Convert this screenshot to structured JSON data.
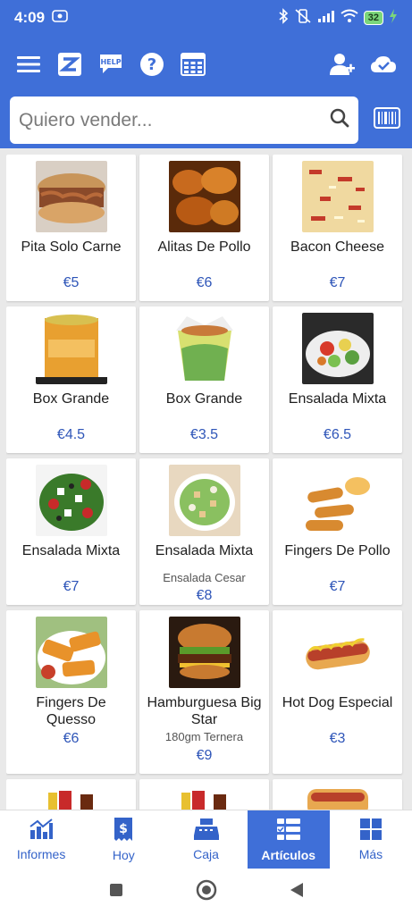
{
  "status": {
    "time": "4:09",
    "battery": "32"
  },
  "search": {
    "placeholder": "Quiero vender..."
  },
  "products": [
    {
      "name": "Pita Solo Carne",
      "price": "€5"
    },
    {
      "name": "Alitas De Pollo",
      "price": "€6"
    },
    {
      "name": "Bacon Cheese",
      "price": "€7"
    },
    {
      "name": "Box Grande",
      "price": "€4.5"
    },
    {
      "name": "Box Grande",
      "price": "€3.5"
    },
    {
      "name": "Ensalada Mixta",
      "price": "€6.5"
    },
    {
      "name": "Ensalada Mixta",
      "price": "€7"
    },
    {
      "name": "Ensalada Mixta",
      "subtitle": "Ensalada Cesar",
      "price": "€8"
    },
    {
      "name": "Fingers De Pollo",
      "price": "€7"
    },
    {
      "name": "Fingers De Quesso",
      "price": "€6"
    },
    {
      "name": "Hamburguesa Big Star",
      "subtitle": "180gm Ternera",
      "price": "€9"
    },
    {
      "name": "Hot Dog Especial",
      "price": "€3"
    }
  ],
  "nav": [
    {
      "label": "Informes",
      "icon": "chart-icon"
    },
    {
      "label": "Hoy",
      "icon": "receipt-icon"
    },
    {
      "label": "Caja",
      "icon": "register-icon"
    },
    {
      "label": "Artículos",
      "icon": "list-icon"
    },
    {
      "label": "Más",
      "icon": "grid-icon"
    }
  ],
  "colors": {
    "primary": "#3f6fd8",
    "price": "#2e55b8"
  }
}
